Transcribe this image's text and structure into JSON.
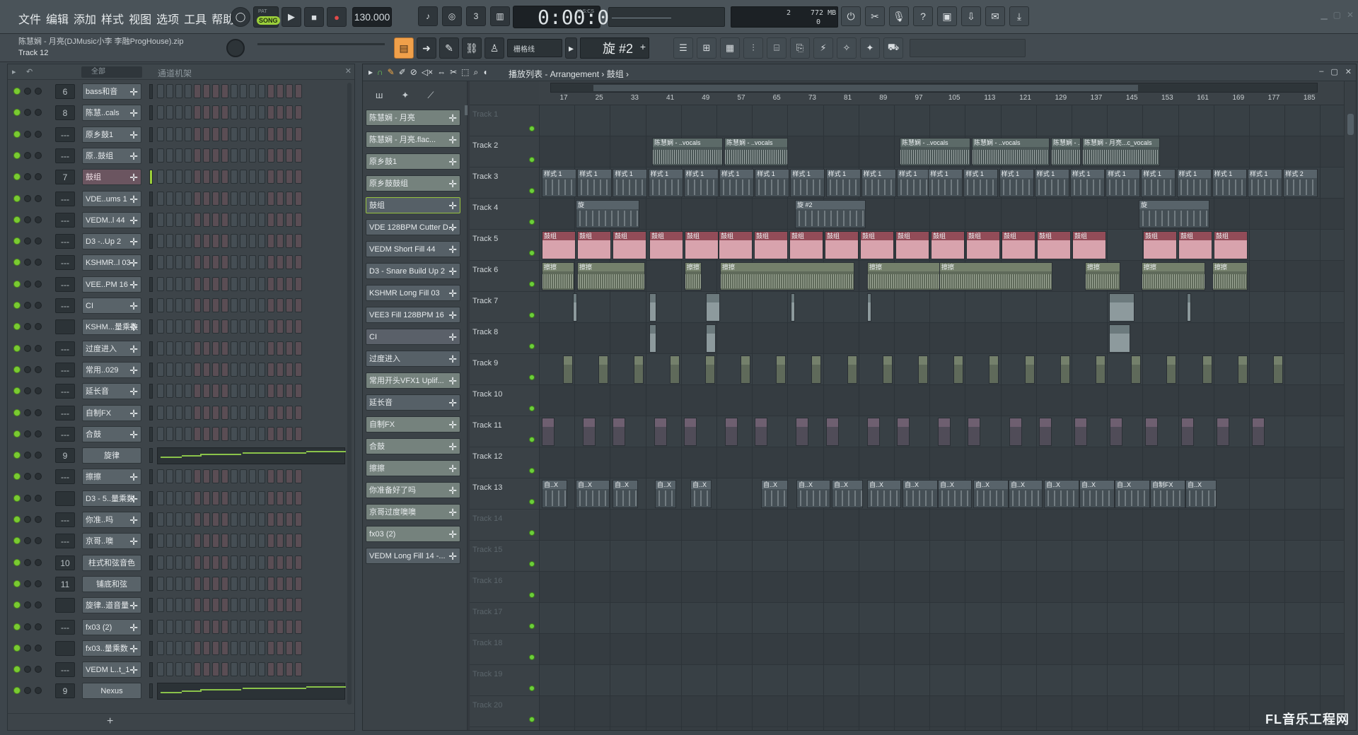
{
  "menu": [
    "文件",
    "编辑",
    "添加",
    "样式",
    "视图",
    "选项",
    "工具",
    "帮助"
  ],
  "transport": {
    "song_label": "SONG",
    "pat_label": "PAT",
    "tempo": "130.000",
    "time": "0:00:00",
    "time_unit": "M:S:CS"
  },
  "monitor": {
    "cpu": "2",
    "mem": "772 MB",
    "poly": "0"
  },
  "project": {
    "file": "陈慧娴 - 月亮(DJMusic小李 李融ProgHouse).zip",
    "hint": "Track 12"
  },
  "pattern_bar": {
    "snap": "栅格线",
    "pattern": "旋 #2"
  },
  "rack": {
    "filter": "全部",
    "title": "通道机架",
    "channels": [
      {
        "mix": "6",
        "name": "bass和音"
      },
      {
        "mix": "8",
        "name": "陈慧..cals"
      },
      {
        "mix": "---",
        "name": "原乡鼓1"
      },
      {
        "mix": "---",
        "name": "原..鼓组"
      },
      {
        "mix": "7",
        "name": "鼓组"
      },
      {
        "mix": "---",
        "name": "VDE..ums 1"
      },
      {
        "mix": "---",
        "name": "VEDM..l 44"
      },
      {
        "mix": "---",
        "name": "D3 -..Up 2"
      },
      {
        "mix": "---",
        "name": "KSHMR..l 03"
      },
      {
        "mix": "---",
        "name": "VEE..PM 16"
      },
      {
        "mix": "---",
        "name": "CI"
      },
      {
        "mix": "",
        "name": "KSHM...量乘数"
      },
      {
        "mix": "---",
        "name": "过度进入"
      },
      {
        "mix": "---",
        "name": "常用..029"
      },
      {
        "mix": "---",
        "name": "延长音"
      },
      {
        "mix": "---",
        "name": "自制FX"
      },
      {
        "mix": "---",
        "name": "合鼓"
      },
      {
        "mix": "9",
        "name": "旋律"
      },
      {
        "mix": "---",
        "name": "擦擦"
      },
      {
        "mix": "",
        "name": "D3 - 5..量乘数"
      },
      {
        "mix": "---",
        "name": "你准..吗"
      },
      {
        "mix": "---",
        "name": "京哥..噢"
      },
      {
        "mix": "10",
        "name": "柱式和弦音色"
      },
      {
        "mix": "11",
        "name": "铺底和弦"
      },
      {
        "mix": "",
        "name": "旋律..道音量"
      },
      {
        "mix": "---",
        "name": "fx03 (2)"
      },
      {
        "mix": "",
        "name": "fx03..量乘数"
      },
      {
        "mix": "---",
        "name": "VEDM L..t_1"
      },
      {
        "mix": "9",
        "name": "Nexus"
      }
    ]
  },
  "playlist": {
    "title": "播放列表 - Arrangement › 鼓组 ›",
    "clips": [
      "陈慧娴 - 月亮",
      "陈慧娴 - 月亮.flac...",
      "原乡鼓1",
      "原乡鼓鼓组",
      "鼓组",
      "VDE 128BPM Cutter D...",
      "VEDM Short Fill 44",
      "D3 - Snare Build Up 2",
      "KSHMR Long Fill 03",
      "VEE3 Fill 128BPM 16",
      "CI",
      "过度进入",
      "常用开头VFX1 Uplif...",
      "延长音",
      "自制FX",
      "合鼓",
      "擦擦",
      "你准备好了吗",
      "京哥过度噢噢",
      "fx03 (2)",
      "VEDM Long Fill 14 -..."
    ],
    "ruler": [
      "17",
      "25",
      "33",
      "41",
      "49",
      "57",
      "65",
      "73",
      "81",
      "89",
      "97",
      "105",
      "113",
      "121",
      "129",
      "137",
      "145",
      "153",
      "161",
      "169",
      "177",
      "185"
    ],
    "tracks": [
      "Track 1",
      "Track 2",
      "Track 3",
      "Track 4",
      "Track 5",
      "Track 6",
      "Track 7",
      "Track 8",
      "Track 9",
      "Track 10",
      "Track 11",
      "Track 12",
      "Track 13",
      "Track 14",
      "Track 15",
      "Track 16",
      "Track 17",
      "Track 18",
      "Track 19",
      "Track 20"
    ],
    "clip_labels": {
      "vocals": "陈慧娴 - ..vocals",
      "vocals_end": "陈慧娴 - 月亮...c_vocals",
      "pattern1": "样式 1",
      "pattern2": "样式 2",
      "melody": "旋",
      "melody2": "旋 #2",
      "drums": "鼓组",
      "rub": "擦擦",
      "self": "自..X",
      "selffx": "自制FX"
    }
  },
  "watermark": "FL音乐工程网"
}
